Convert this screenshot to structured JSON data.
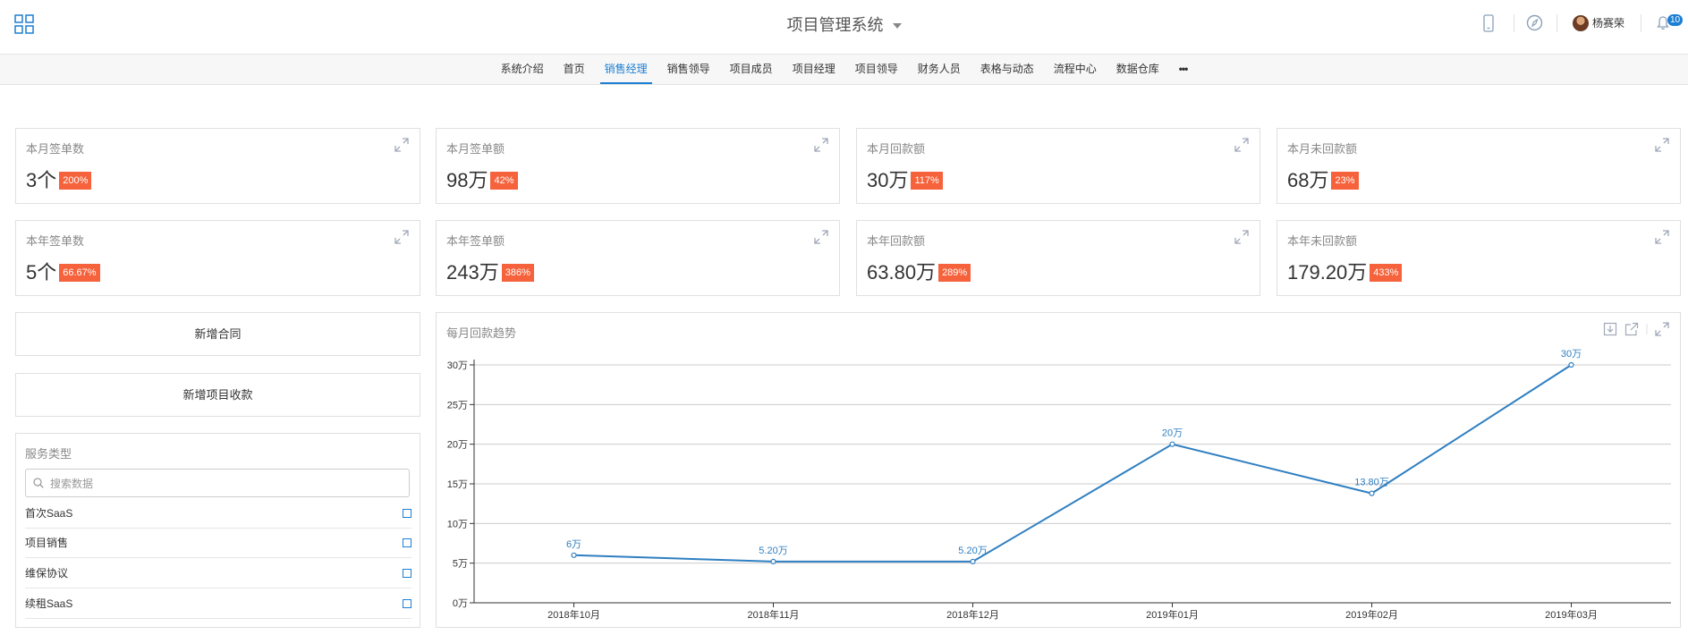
{
  "header": {
    "title": "项目管理系统",
    "username": "杨赛荣",
    "notification_count": "10"
  },
  "nav": {
    "items": [
      {
        "label": "系统介绍"
      },
      {
        "label": "首页"
      },
      {
        "label": "销售经理",
        "active": true
      },
      {
        "label": "销售领导"
      },
      {
        "label": "项目成员"
      },
      {
        "label": "项目经理"
      },
      {
        "label": "项目领导"
      },
      {
        "label": "财务人员"
      },
      {
        "label": "表格与动态"
      },
      {
        "label": "流程中心"
      },
      {
        "label": "数据仓库"
      },
      {
        "label": "•••"
      }
    ]
  },
  "stats": [
    {
      "label": "本月签单数",
      "value": "3个",
      "badge": "200%"
    },
    {
      "label": "本月签单额",
      "value": "98万",
      "badge": "42%"
    },
    {
      "label": "本月回款额",
      "value": "30万",
      "badge": "117%"
    },
    {
      "label": "本月未回款额",
      "value": "68万",
      "badge": "23%"
    },
    {
      "label": "本年签单数",
      "value": "5个",
      "badge": "66.67%"
    },
    {
      "label": "本年签单额",
      "value": "243万",
      "badge": "386%"
    },
    {
      "label": "本年回款额",
      "value": "63.80万",
      "badge": "289%"
    },
    {
      "label": "本年未回款额",
      "value": "179.20万",
      "badge": "433%"
    }
  ],
  "actions": {
    "add_contract": "新增合同",
    "add_payment": "新增项目收款"
  },
  "filter": {
    "title": "服务类型",
    "search_placeholder": "搜索数据",
    "options": [
      "首次SaaS",
      "项目销售",
      "维保协议",
      "续租SaaS"
    ]
  },
  "colors": {
    "accent": "#1c7fd3",
    "badge": "#f5623b",
    "line": "#2f7fc1"
  },
  "chart_data": {
    "type": "line",
    "title": "每月回款趋势",
    "categories": [
      "2018年10月",
      "2018年11月",
      "2018年12月",
      "2019年01月",
      "2019年02月",
      "2019年03月"
    ],
    "values": [
      6,
      5.2,
      5.2,
      20,
      13.8,
      30
    ],
    "data_labels": [
      "6万",
      "5.20万",
      "5.20万",
      "20万",
      "13.80万",
      "30万"
    ],
    "yticks": [
      "0万",
      "5万",
      "10万",
      "15万",
      "20万",
      "25万",
      "30万"
    ],
    "ylim": [
      0,
      30
    ],
    "grid": true
  }
}
